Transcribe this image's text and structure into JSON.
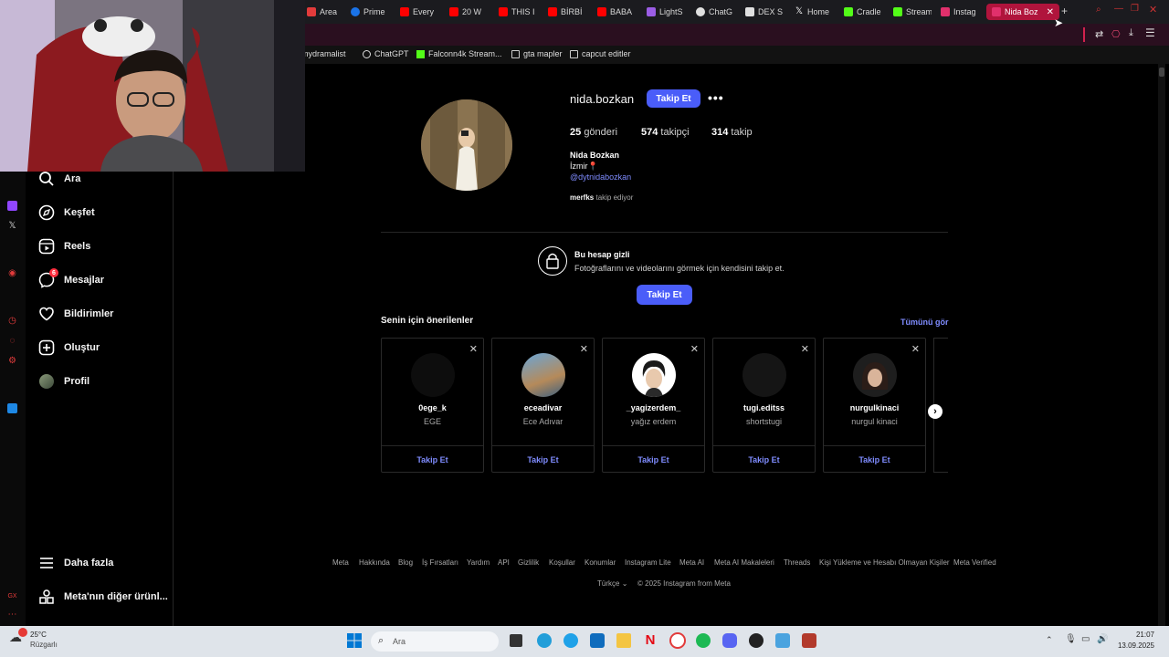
{
  "browser": {
    "tabs": [
      {
        "label": "Area n",
        "color": "#e23b3b"
      },
      {
        "label": "Prime",
        "color": "#1a73e8"
      },
      {
        "label": "Every",
        "color": "#ff0000"
      },
      {
        "label": "20 W",
        "color": "#ff0000"
      },
      {
        "label": "THIS I",
        "color": "#ff0000"
      },
      {
        "label": "BİRBİ",
        "color": "#ff0000"
      },
      {
        "label": "BABA",
        "color": "#ff0000"
      },
      {
        "label": "LightS",
        "color": "#9b5de5"
      },
      {
        "label": "ChatG",
        "color": "#e0e0e0"
      },
      {
        "label": "DEX S",
        "color": "#e0e0e0"
      },
      {
        "label": "Home",
        "color": "#e0e0e0"
      },
      {
        "label": "Cradle",
        "color": "#53fc18"
      },
      {
        "label": "Stream",
        "color": "#53fc18"
      },
      {
        "label": "Instag",
        "color": "#e1306c"
      }
    ],
    "active_tab": "Nida Boz",
    "bookmarks": [
      {
        "label": "mydramalist"
      },
      {
        "label": "ChatGPT"
      },
      {
        "label": "Falconn4k Stream..."
      },
      {
        "label": "gta mapler"
      },
      {
        "label": "capcut editler"
      }
    ]
  },
  "sidebar": {
    "items": [
      {
        "label": "Ara",
        "icon": "search-icon"
      },
      {
        "label": "Keşfet",
        "icon": "compass-icon"
      },
      {
        "label": "Reels",
        "icon": "reels-icon"
      },
      {
        "label": "Mesajlar",
        "icon": "messenger-icon",
        "badge": "6"
      },
      {
        "label": "Bildirimler",
        "icon": "heart-icon"
      },
      {
        "label": "Oluştur",
        "icon": "plus-icon"
      },
      {
        "label": "Profil",
        "icon": "avatar-icon"
      }
    ],
    "more": "Daha fazla",
    "meta_products": "Meta'nın diğer ürünl..."
  },
  "profile": {
    "username": "nida.bozkan",
    "follow_button": "Takip Et",
    "posts_count": "25",
    "posts_label": "gönderi",
    "followers_count": "574",
    "followers_label": "takipçi",
    "following_count": "314",
    "following_label": "takip",
    "full_name": "Nida Bozkan",
    "bio_line": "İzmir📍",
    "bio_link": "@dytnidabozkan",
    "followed_by_user": "merfks",
    "followed_by_text": "takip ediyor"
  },
  "private": {
    "title": "Bu hesap gizli",
    "subtitle": "Fotoğraflarını ve videolarını görmek için kendisini takip et.",
    "button": "Takip Et"
  },
  "suggestions": {
    "heading": "Senin için önerilenler",
    "see_all": "Tümünü gör",
    "cards": [
      {
        "username": "0ege_k",
        "name": "EGE",
        "button": "Takip Et"
      },
      {
        "username": "eceadivar",
        "name": "Ece Adıvar",
        "button": "Takip Et"
      },
      {
        "username": "_yagizerdem_",
        "name": "yağız erdem",
        "button": "Takip Et"
      },
      {
        "username": "tugi.editss",
        "name": "shortstugi",
        "button": "Takip Et"
      },
      {
        "username": "nurgulkinaci",
        "name": "nurgul kinaci",
        "button": "Takip Et"
      }
    ]
  },
  "footer": {
    "links": [
      "Meta",
      "Hakkında",
      "Blog",
      "İş Fırsatları",
      "Yardım",
      "API",
      "Gizlilik",
      "Koşullar",
      "Konumlar",
      "Instagram Lite",
      "Meta AI",
      "Meta AI Makaleleri",
      "Threads",
      "Kişi Yükleme ve Hesabı Olmayan Kişiler",
      "Meta Verified"
    ],
    "language": "Türkçe",
    "copyright": "© 2025 Instagram from Meta"
  },
  "taskbar": {
    "weather_temp": "25°C",
    "weather_desc": "Rüzgarlı",
    "search": "Ara",
    "time": "21:07",
    "date": "13.09.2025"
  },
  "colors": {
    "accent": "#4a5df9",
    "link": "#7f8cff",
    "active_tab": "#b0143c"
  }
}
